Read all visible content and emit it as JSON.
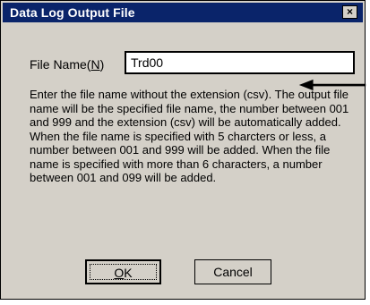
{
  "window": {
    "title": "Data Log Output File",
    "close_label": "×"
  },
  "form": {
    "file_name_label_prefix": "File Name(",
    "file_name_label_hotkey": "N",
    "file_name_label_suffix": ")",
    "file_name_value": "Trd00"
  },
  "description": {
    "paragraph1": "Enter the file name without the extension (csv). The output file name will be the specified file name, the number between 001 and 999 and the extension (csv) will be automatically added.",
    "paragraph2": "When the file name is specified with 5 charcters or less, a number between 001 and 999 will be added. When the file name is specified with more than 6 characters, a number between 001 and 099 will be added."
  },
  "buttons": {
    "ok_hotkey": "O",
    "ok_rest": "K",
    "cancel_label": "Cancel"
  }
}
